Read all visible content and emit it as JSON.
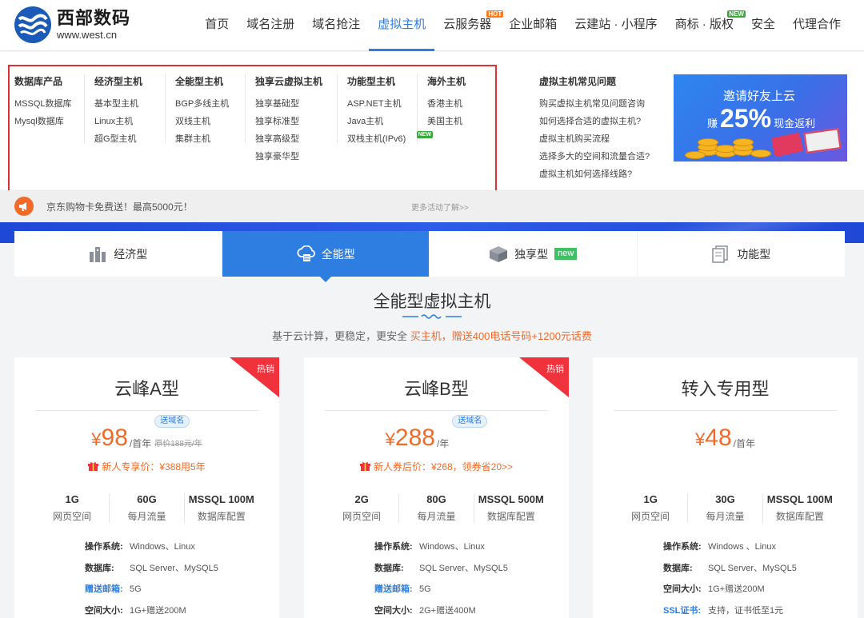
{
  "logo": {
    "name_cn": "西部数码",
    "domain": "www.west.cn"
  },
  "nav": [
    {
      "label": "首页"
    },
    {
      "label": "域名注册"
    },
    {
      "label": "域名抢注"
    },
    {
      "label": "虚拟主机",
      "active": true
    },
    {
      "label": "云服务器",
      "badge": "HOT"
    },
    {
      "label": "企业邮箱"
    },
    {
      "label": "云建站 · 小程序"
    },
    {
      "label": "商标 · 版权",
      "badge": "NEW"
    },
    {
      "label": "安全"
    },
    {
      "label": "代理合作"
    }
  ],
  "dropdown": {
    "columns": [
      {
        "title": "数据库产品",
        "links": [
          "MSSQL数据库",
          "Mysql数据库"
        ]
      },
      {
        "title": "经济型主机",
        "links": [
          "基本型主机",
          "Linux主机",
          "超G型主机"
        ]
      },
      {
        "title": "全能型主机",
        "links": [
          "BGP多线主机",
          "双线主机",
          "集群主机"
        ]
      },
      {
        "title": "独享云虚拟主机",
        "links": [
          "独享基础型",
          "独享标准型",
          "独享高级型",
          "独享豪华型"
        ]
      },
      {
        "title": "功能型主机",
        "links": [
          "ASP.NET主机",
          "Java主机",
          "双栈主机(IPv6)"
        ],
        "new_badge": "NEW"
      },
      {
        "title": "海外主机",
        "links": [
          "香港主机",
          "美国主机"
        ]
      }
    ],
    "faq": {
      "title": "虚拟主机常见问题",
      "links": [
        "购买虚拟主机常见问题咨询",
        "如何选择合适的虚拟主机?",
        "虚拟主机购买流程",
        "选择多大的空间和流量合适?",
        "虚拟主机如何选择线路?"
      ]
    },
    "banner": {
      "title": "邀请好友上云",
      "pre": "赚",
      "percent": "25%",
      "post": "现金返利"
    }
  },
  "promo": {
    "text": "京东购物卡免费送！最高5000元！",
    "more": "更多活动了解>>"
  },
  "tabs": [
    {
      "label": "经济型",
      "icon": "server-rack-icon"
    },
    {
      "label": "全能型",
      "icon": "cloud-server-icon",
      "active": true
    },
    {
      "label": "独享型",
      "icon": "cube-icon",
      "badge": "new"
    },
    {
      "label": "功能型",
      "icon": "document-stack-icon"
    }
  ],
  "section": {
    "title": "全能型虚拟主机",
    "subtitle": "基于云计算，更稳定，更安全",
    "highlight": "买主机，赠送400电话号码+1200元话费"
  },
  "cards": [
    {
      "name": "云峰A型",
      "ribbon": "热销",
      "price": "98",
      "currency": "¥",
      "unit": "/首年",
      "tag": "送域名",
      "orig": "原价188元/年",
      "offer": "新人专享价：¥388用5年",
      "specs": [
        {
          "value": "1G",
          "label": "网页空间"
        },
        {
          "value": "60G",
          "label": "每月流量"
        },
        {
          "value": "MSSQL 100M",
          "label": "数据库配置"
        }
      ],
      "details": [
        {
          "k": "操作系统:",
          "v": "Windows、Linux"
        },
        {
          "k": "数据库:",
          "v": "SQL Server、MySQL5"
        },
        {
          "k": "赠送邮箱:",
          "v": "5G",
          "blue": true
        },
        {
          "k": "空间大小:",
          "v": "1G+赠送200M"
        }
      ]
    },
    {
      "name": "云峰B型",
      "ribbon": "热销",
      "price": "288",
      "currency": "¥",
      "unit": "/年",
      "tag": "送域名",
      "orig": "",
      "offer": "新人券后价：¥268，领券省20>>",
      "specs": [
        {
          "value": "2G",
          "label": "网页空间"
        },
        {
          "value": "80G",
          "label": "每月流量"
        },
        {
          "value": "MSSQL 500M",
          "label": "数据库配置"
        }
      ],
      "details": [
        {
          "k": "操作系统:",
          "v": "Windows、Linux"
        },
        {
          "k": "数据库:",
          "v": "SQL Server、MySQL5"
        },
        {
          "k": "赠送邮箱:",
          "v": "5G",
          "blue": true
        },
        {
          "k": "空间大小:",
          "v": "2G+赠送400M"
        }
      ]
    },
    {
      "name": "转入专用型",
      "ribbon": "",
      "price": "48",
      "currency": "¥",
      "unit": "/首年",
      "tag": "",
      "orig": "",
      "offer": "",
      "specs": [
        {
          "value": "1G",
          "label": "网页空间"
        },
        {
          "value": "30G",
          "label": "每月流量"
        },
        {
          "value": "MSSQL 100M",
          "label": "数据库配置"
        }
      ],
      "details": [
        {
          "k": "操作系统:",
          "v": "Windows 、Linux"
        },
        {
          "k": "数据库:",
          "v": "SQL Server、MySQL5"
        },
        {
          "k": "空间大小:",
          "v": "1G+赠送200M"
        },
        {
          "k": "SSL证书:",
          "v": "支持，证书低至1元",
          "blue": true
        }
      ]
    }
  ],
  "colors": {
    "accent": "#2d7ee0",
    "price": "#f26a28",
    "ribbon": "#f0323c",
    "outline": "#e0303a"
  }
}
